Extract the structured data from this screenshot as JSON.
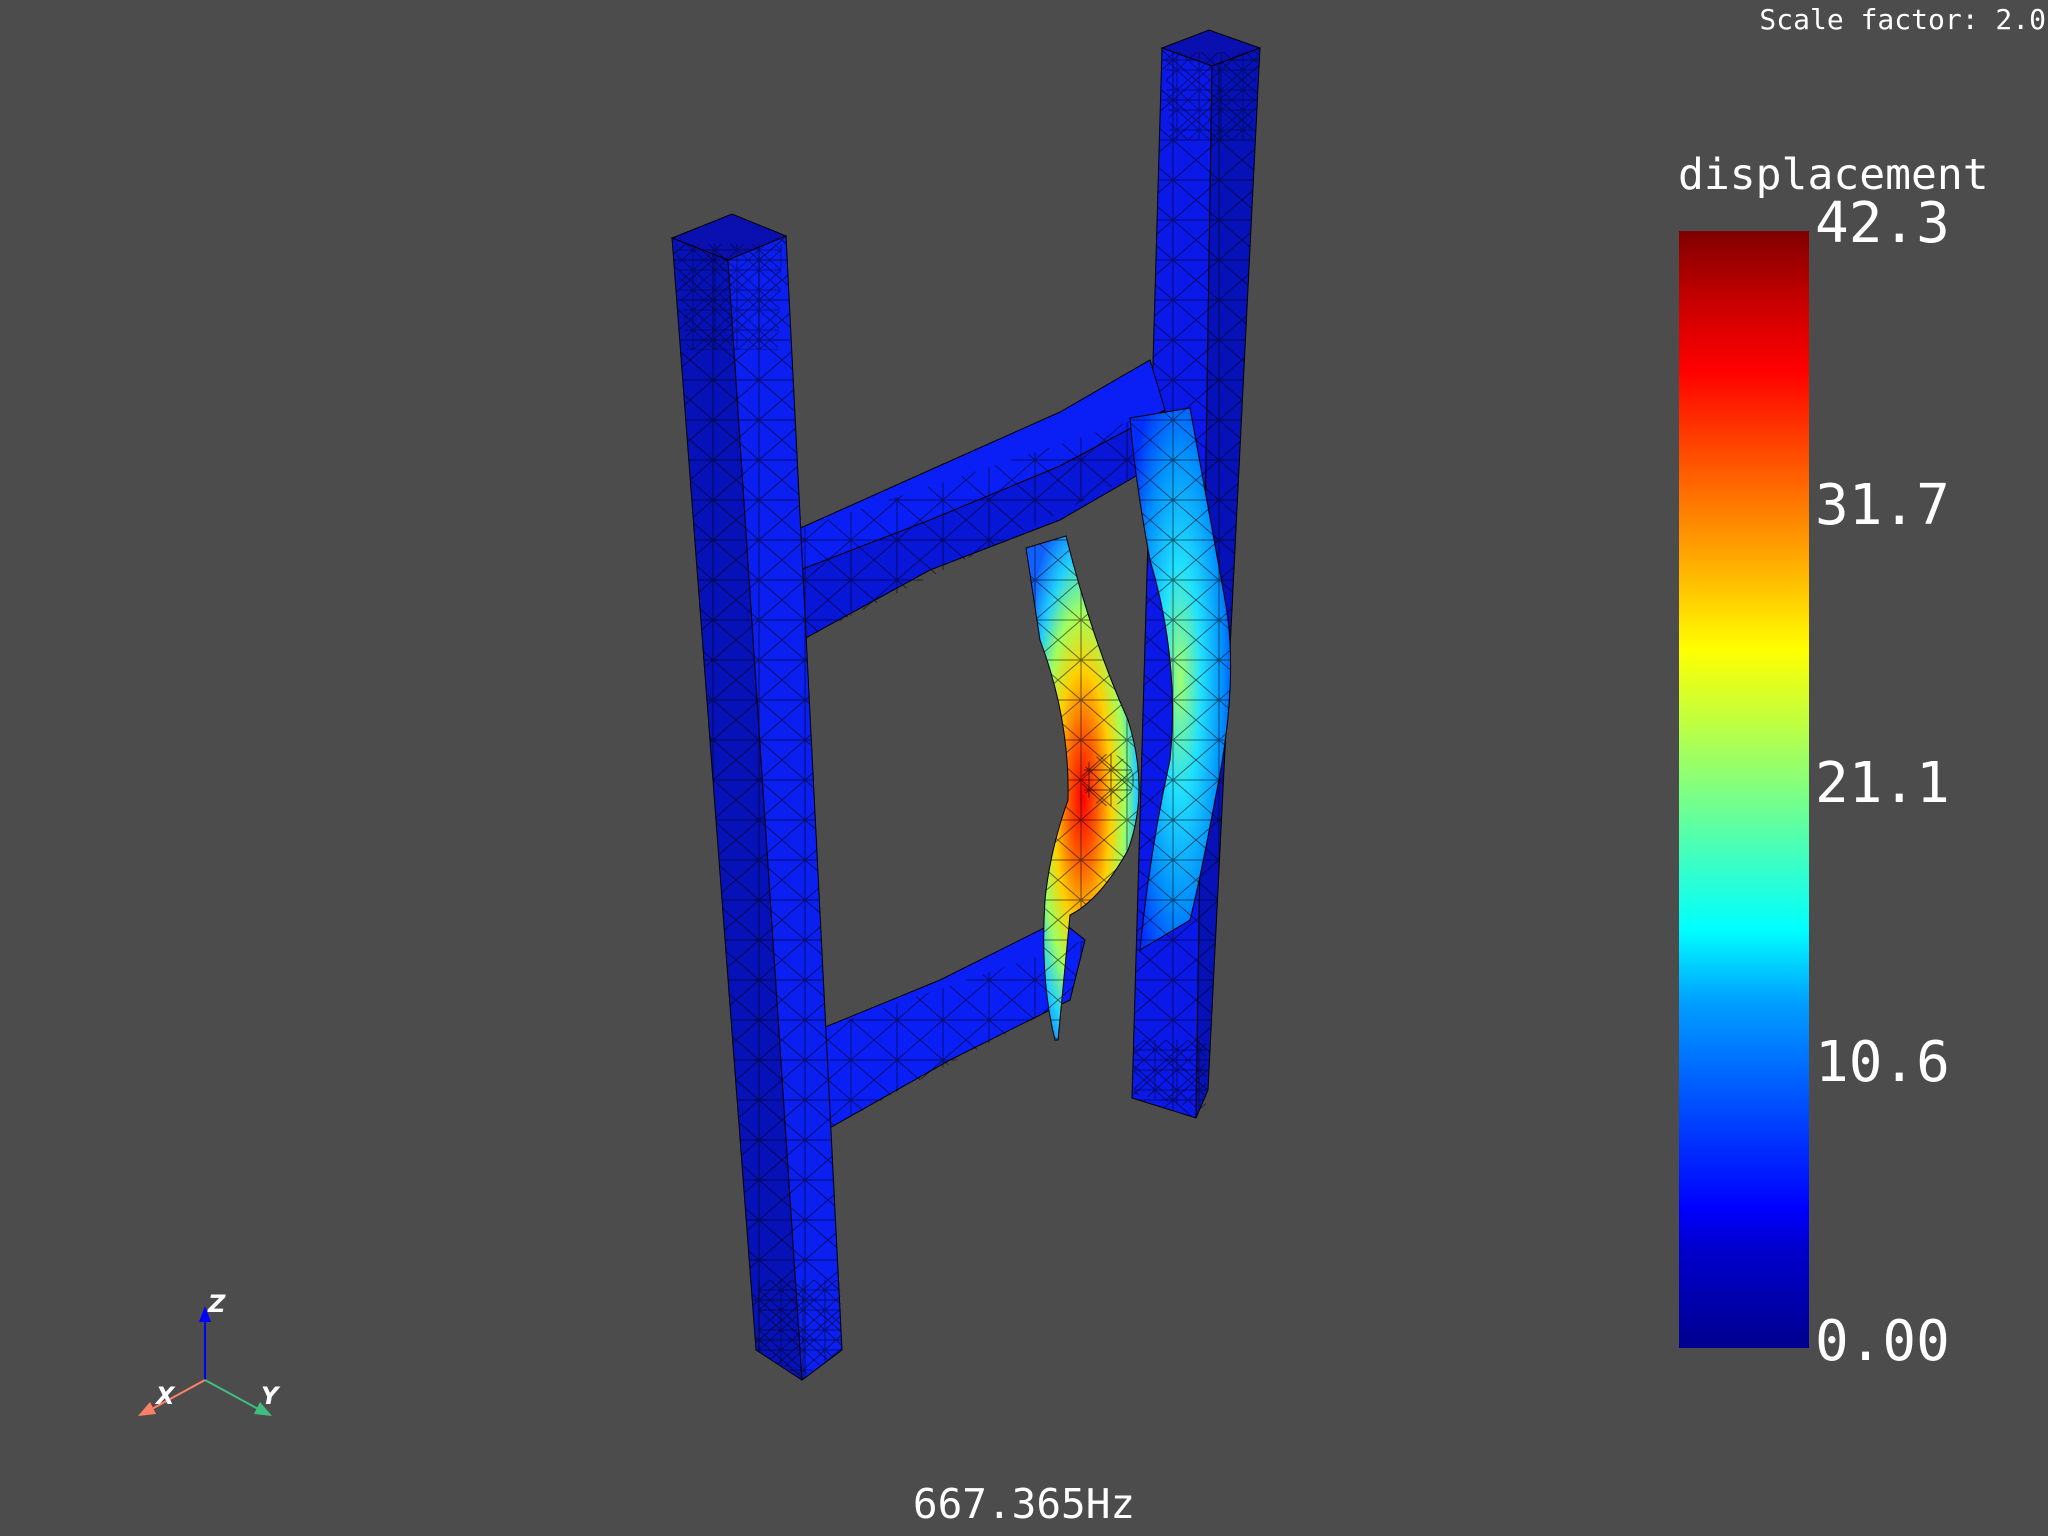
{
  "scale_factor_label": "Scale factor: 2.0",
  "frequency_label": "667.365Hz",
  "colorbar": {
    "title": "displacement",
    "min": 0.0,
    "max": 42.3,
    "ticks": [
      "42.3",
      "31.7",
      "21.1",
      "10.6",
      "0.00"
    ],
    "colormap": "jet",
    "colors": [
      "#00008f",
      "#0000ff",
      "#00ffff",
      "#ffff00",
      "#ff0000",
      "#800000"
    ]
  },
  "axes_widget": {
    "x": {
      "label": "X",
      "color": "#ff7f66"
    },
    "y": {
      "label": "Y",
      "color": "#3fbf7f"
    },
    "z": {
      "label": "Z",
      "color": "#0000ff"
    }
  },
  "colors": {
    "background": "#4c4c4c",
    "mesh_base": "#0a18f0",
    "mesh_lines": "#000000"
  }
}
